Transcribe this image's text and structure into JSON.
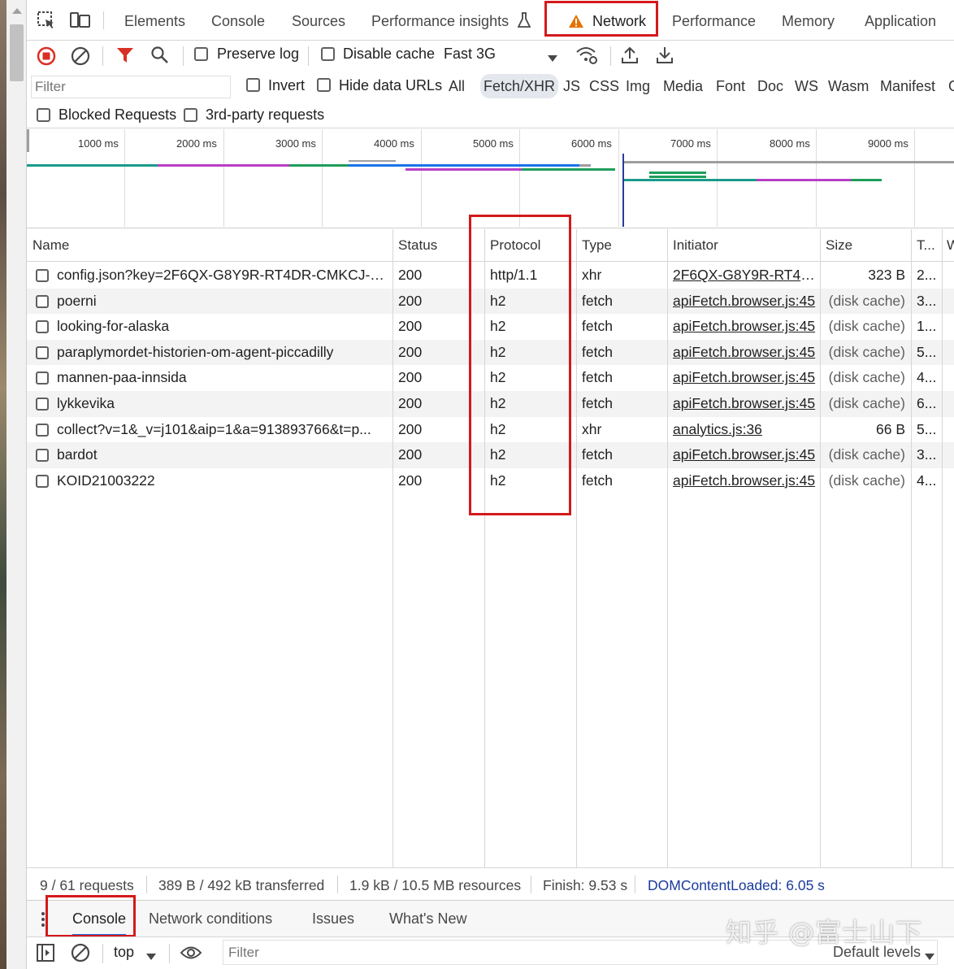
{
  "tabs": {
    "elements": "Elements",
    "console": "Console",
    "sources": "Sources",
    "performance_insights": "Performance insights",
    "network": "Network",
    "performance": "Performance",
    "memory": "Memory",
    "application": "Application"
  },
  "toolbar": {
    "preserve_log": "Preserve log",
    "disable_cache": "Disable cache",
    "throttling": "Fast 3G"
  },
  "filter": {
    "placeholder": "Filter",
    "invert": "Invert",
    "hide_data_urls": "Hide data URLs",
    "types": [
      "All",
      "Fetch/XHR",
      "JS",
      "CSS",
      "Img",
      "Media",
      "Font",
      "Doc",
      "WS",
      "Wasm",
      "Manifest",
      "O"
    ],
    "active_type": "Fetch/XHR",
    "blocked_requests": "Blocked Requests",
    "third_party": "3rd-party requests"
  },
  "overview": {
    "ticks": [
      "1000 ms",
      "2000 ms",
      "3000 ms",
      "4000 ms",
      "5000 ms",
      "6000 ms",
      "7000 ms",
      "8000 ms",
      "9000 ms"
    ],
    "colors": {
      "green": "#1e9e5a",
      "purple": "#b93ec7",
      "blue": "#1a73e8",
      "grey": "#9e9e9e",
      "teal": "#199a8a"
    }
  },
  "table": {
    "headers": {
      "name": "Name",
      "status": "Status",
      "protocol": "Protocol",
      "type": "Type",
      "initiator": "Initiator",
      "size": "Size",
      "time": "T...",
      "waterfall": "W"
    },
    "rows": [
      {
        "name": "config.json?key=2F6QX-G8Y9R-RT4DR-CMKCJ-G...",
        "status": "200",
        "protocol": "http/1.1",
        "type": "xhr",
        "initiator": "2F6QX-G8Y9R-RT4D...",
        "size": "323 B",
        "time": "2..."
      },
      {
        "name": "poerni",
        "status": "200",
        "protocol": "h2",
        "type": "fetch",
        "initiator": "apiFetch.browser.js:45",
        "size": "(disk cache)",
        "time": "3..."
      },
      {
        "name": "looking-for-alaska",
        "status": "200",
        "protocol": "h2",
        "type": "fetch",
        "initiator": "apiFetch.browser.js:45",
        "size": "(disk cache)",
        "time": "1..."
      },
      {
        "name": "paraplymordet-historien-om-agent-piccadilly",
        "status": "200",
        "protocol": "h2",
        "type": "fetch",
        "initiator": "apiFetch.browser.js:45",
        "size": "(disk cache)",
        "time": "5..."
      },
      {
        "name": "mannen-paa-innsida",
        "status": "200",
        "protocol": "h2",
        "type": "fetch",
        "initiator": "apiFetch.browser.js:45",
        "size": "(disk cache)",
        "time": "4..."
      },
      {
        "name": "lykkevika",
        "status": "200",
        "protocol": "h2",
        "type": "fetch",
        "initiator": "apiFetch.browser.js:45",
        "size": "(disk cache)",
        "time": "6..."
      },
      {
        "name": "collect?v=1&_v=j101&aip=1&a=913893766&t=p...",
        "status": "200",
        "protocol": "h2",
        "type": "xhr",
        "initiator": "analytics.js:36",
        "size": "66 B",
        "time": "5..."
      },
      {
        "name": "bardot",
        "status": "200",
        "protocol": "h2",
        "type": "fetch",
        "initiator": "apiFetch.browser.js:45",
        "size": "(disk cache)",
        "time": "3..."
      },
      {
        "name": "KOID21003222",
        "status": "200",
        "protocol": "h2",
        "type": "fetch",
        "initiator": "apiFetch.browser.js:45",
        "size": "(disk cache)",
        "time": "4..."
      }
    ]
  },
  "summary": {
    "requests": "9 / 61 requests",
    "transferred": "389 B / 492 kB transferred",
    "resources": "1.9 kB / 10.5 MB resources",
    "finish": "Finish: 9.53 s",
    "dom_content_loaded": "DOMContentLoaded: 6.05 s"
  },
  "drawer": {
    "tabs": [
      "Console",
      "Network conditions",
      "Issues",
      "What's New"
    ],
    "context": "top",
    "filter_placeholder": "Filter",
    "levels": "Default levels"
  },
  "watermark": "知乎 @富士山下",
  "colors": {
    "highlight": "#d3191c",
    "warning": "#e37400",
    "record": "#d93025",
    "filter_active": "#d93025",
    "dcl": "#1a3a9e"
  }
}
